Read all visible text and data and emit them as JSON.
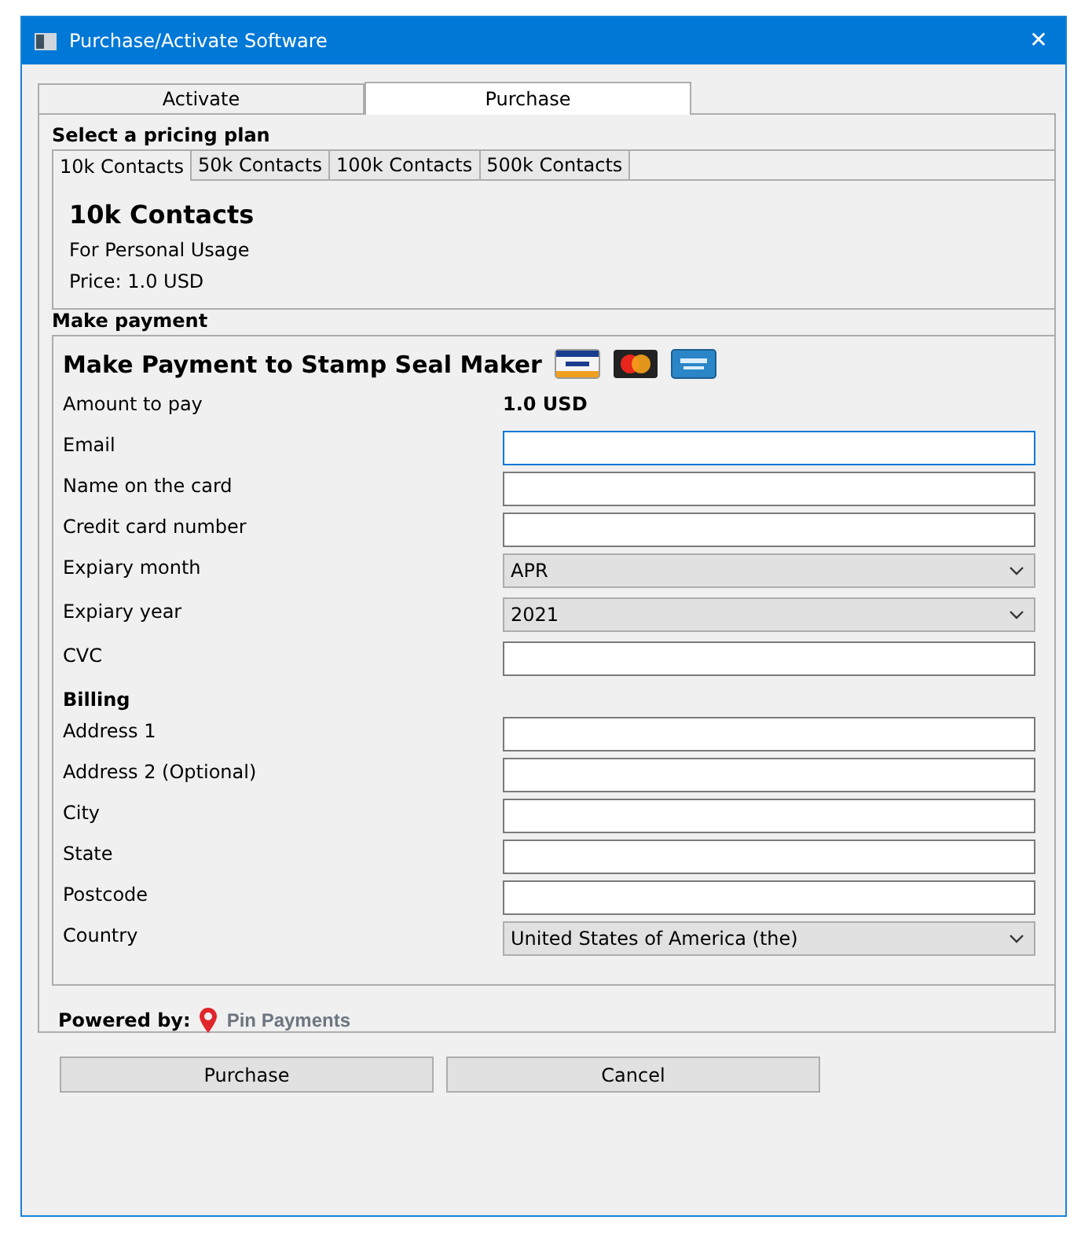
{
  "window": {
    "title": "Purchase/Activate Software",
    "close": "✕"
  },
  "tabs": [
    {
      "label": "Activate",
      "selected": false
    },
    {
      "label": "Purchase",
      "selected": true
    }
  ],
  "plan_section": {
    "title": "Select a pricing plan",
    "tabs": [
      {
        "label": "10k Contacts",
        "selected": true
      },
      {
        "label": "50k Contacts",
        "selected": false
      },
      {
        "label": "100k Contacts",
        "selected": false
      },
      {
        "label": "500k Contacts",
        "selected": false
      }
    ],
    "plan_name": "10k Contacts",
    "description": "For Personal Usage",
    "price": "Price: 1.0 USD"
  },
  "payment_section": {
    "title": "Make payment",
    "heading": "Make Payment to Stamp Seal Maker",
    "rows": [
      {
        "kind": "value",
        "label": "Amount to pay",
        "value": "1.0 USD"
      },
      {
        "kind": "text",
        "label": "Email",
        "focused": true
      },
      {
        "kind": "text",
        "label": "Name on the card",
        "focused": false
      },
      {
        "kind": "text",
        "label": "Credit card number",
        "focused": false
      },
      {
        "kind": "select",
        "label": "Expiary month",
        "value": "APR"
      },
      {
        "kind": "select",
        "label": "Expiary year",
        "value": "2021"
      },
      {
        "kind": "text",
        "label": "CVC",
        "focused": false
      },
      {
        "kind": "heading",
        "label": "Billing"
      },
      {
        "kind": "text",
        "label": "Address 1",
        "focused": false
      },
      {
        "kind": "text",
        "label": "Address 2 (Optional)",
        "focused": false
      },
      {
        "kind": "text",
        "label": "City",
        "focused": false
      },
      {
        "kind": "text",
        "label": "State",
        "focused": false
      },
      {
        "kind": "text",
        "label": "Postcode",
        "focused": false
      },
      {
        "kind": "select",
        "label": "Country",
        "value": "United States of America (the)"
      }
    ]
  },
  "powered_by": {
    "label": "Powered by:",
    "brand": "Pin Payments"
  },
  "buttons": [
    "Purchase",
    "Cancel"
  ]
}
